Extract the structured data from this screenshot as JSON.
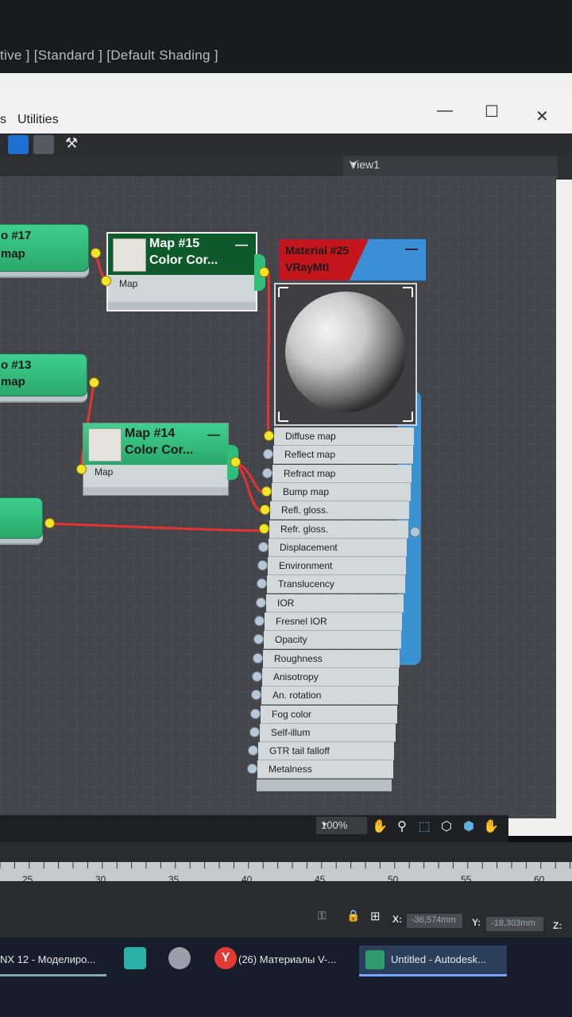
{
  "viewport": {
    "label": "tive ] [Standard ] [Default Shading ]"
  },
  "slate": {
    "menu": {
      "prev_partial": "s",
      "utilities": "Utilities"
    },
    "window_buttons": {
      "minimize": "—",
      "maximize": "☐",
      "close": "✕"
    },
    "view_select": "View1"
  },
  "nodes": {
    "map17": {
      "title_partial": "o #17",
      "type_partial": "map"
    },
    "map13": {
      "title_partial": "o #13",
      "type_partial": "map"
    },
    "map15": {
      "title": "Map #15",
      "type": "Color Cor...",
      "collapse": "—",
      "slot": "Map"
    },
    "map14": {
      "title": "Map #14",
      "type": "Color Cor...",
      "collapse": "—",
      "slot": "Map"
    },
    "material": {
      "title": "Material #25",
      "type": "VRayMtl",
      "collapse": "—",
      "slots": [
        {
          "label": "Diffuse map",
          "connected": true
        },
        {
          "label": "Reflect map",
          "connected": false
        },
        {
          "label": "Refract map",
          "connected": false
        },
        {
          "label": "Bump map",
          "connected": true
        },
        {
          "label": "Refl. gloss.",
          "connected": true
        },
        {
          "label": "Refr. gloss.",
          "connected": true
        },
        {
          "label": "Displacement",
          "connected": false
        },
        {
          "label": "Environment",
          "connected": false
        },
        {
          "label": "Translucency",
          "connected": false
        },
        {
          "label": "IOR",
          "connected": false
        },
        {
          "label": "Fresnel IOR",
          "connected": false
        },
        {
          "label": "Opacity",
          "connected": false
        },
        {
          "label": "Roughness",
          "connected": false
        },
        {
          "label": "Anisotropy",
          "connected": false
        },
        {
          "label": "An. rotation",
          "connected": false
        },
        {
          "label": "Fog color",
          "connected": false
        },
        {
          "label": "Self-illum",
          "connected": false
        },
        {
          "label": "GTR tail falloff",
          "connected": false
        },
        {
          "label": "Metalness",
          "connected": false
        }
      ]
    }
  },
  "canvas": {
    "zoom": "100%"
  },
  "timeline": {
    "ticks": [
      "25",
      "30",
      "35",
      "40",
      "45",
      "50",
      "55",
      "60"
    ],
    "coords": {
      "x_label": "X:",
      "x_value": "-36,574mm",
      "y_label": "Y:",
      "y_value": "-18,303mm",
      "z_label": "Z:"
    }
  },
  "taskbar": {
    "items": [
      "NX 12 - Моделиро...",
      "(26) Материалы V-...",
      "Untitled - Autodesk..."
    ]
  },
  "colors": {
    "connection": "#e83232",
    "socket_connected": "#f5e52a",
    "socket_empty": "#b8c7d6",
    "map_node": "#3fcf8e",
    "material_header_red": "#c4161c",
    "material_header_blue": "#3b8fd6"
  }
}
